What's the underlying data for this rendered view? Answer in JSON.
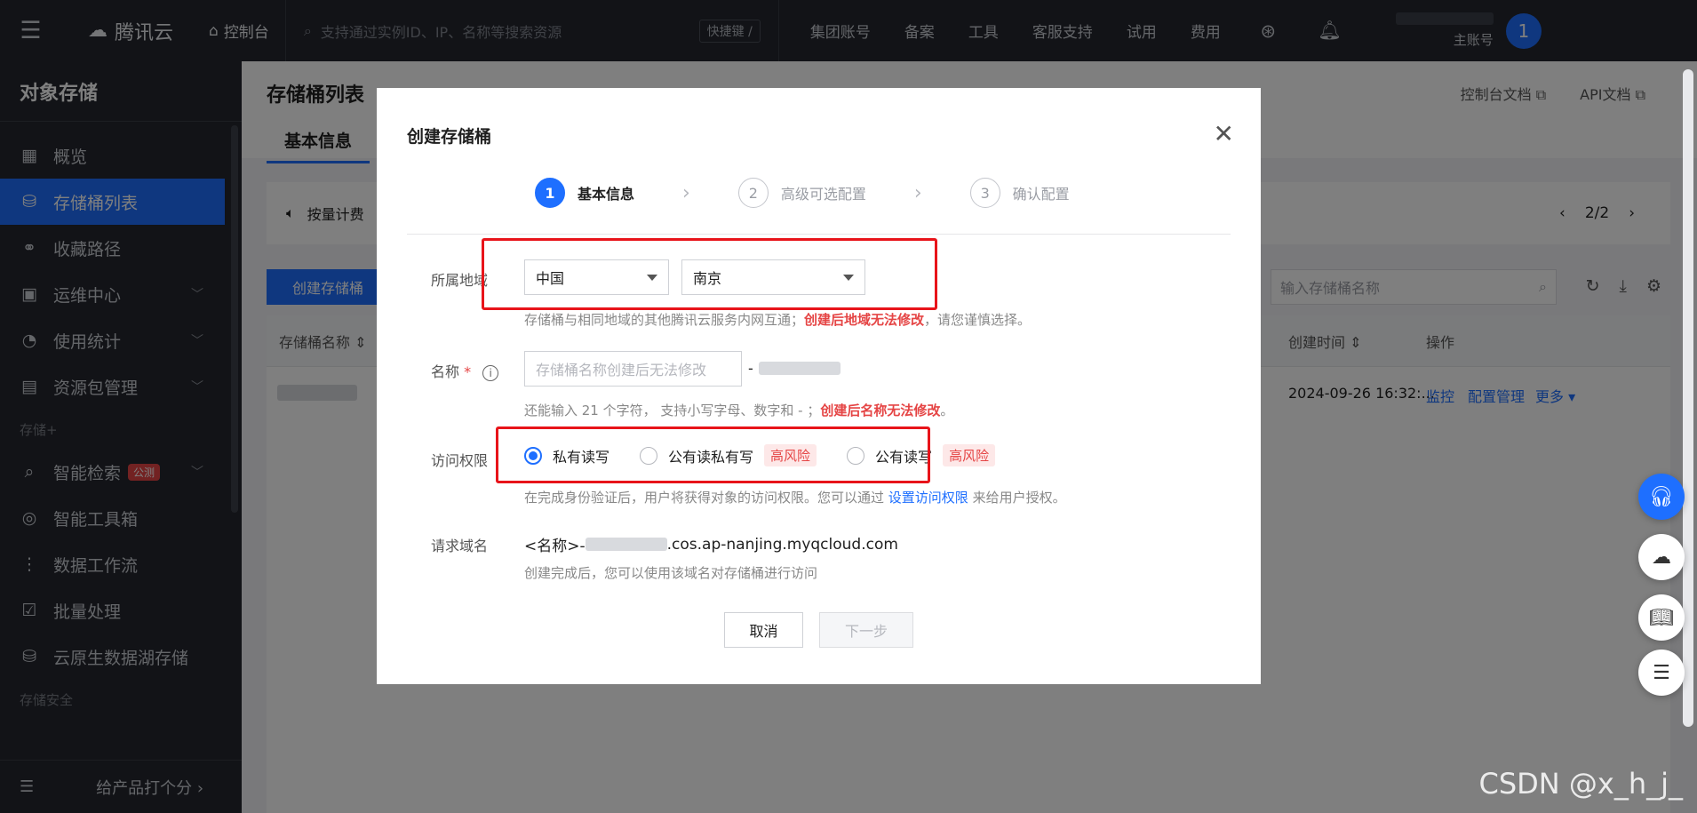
{
  "topbar": {
    "brand": "腾讯云",
    "console": "控制台",
    "search_placeholder": "支持通过实例ID、IP、名称等搜索资源",
    "shortcut": "快捷键 /",
    "links": [
      "集团账号",
      "备案",
      "工具",
      "客服支持",
      "试用",
      "费用"
    ],
    "account_role": "主账号",
    "avatar_initial": "1"
  },
  "sidebar": {
    "title": "对象存储",
    "items": [
      {
        "label": "概览",
        "icon": "grid-icon"
      },
      {
        "label": "存储桶列表",
        "icon": "bucket-icon"
      },
      {
        "label": "收藏路径",
        "icon": "link-icon"
      },
      {
        "label": "运维中心",
        "icon": "calendar-icon"
      },
      {
        "label": "使用统计",
        "icon": "pie-icon"
      },
      {
        "label": "资源包管理",
        "icon": "package-icon"
      }
    ],
    "group_storage_plus": "存储+",
    "plus_items": [
      {
        "label": "智能检索",
        "icon": "search-doc-icon",
        "badge": "公测"
      },
      {
        "label": "智能工具箱",
        "icon": "toolbox-icon"
      },
      {
        "label": "数据工作流",
        "icon": "workflow-icon"
      },
      {
        "label": "批量处理",
        "icon": "batch-icon"
      },
      {
        "label": "云原生数据湖存储",
        "icon": "lake-icon"
      }
    ],
    "group_security": "存储安全",
    "footer_label": "给产品打个分"
  },
  "page": {
    "title": "存储桶列表",
    "tab": "基本信息",
    "doc_links": [
      "控制台文档",
      "API文档"
    ],
    "notice": "按量计费",
    "pager": "2/2",
    "create_button": "创建存储桶",
    "search_placeholder": "输入存储桶名称",
    "columns": [
      "存储桶名称",
      "创建时间",
      "操作"
    ],
    "row": {
      "created": "2024-09-26 16:32:...",
      "actions": [
        "监控",
        "配置管理",
        "更多"
      ]
    }
  },
  "modal": {
    "title": "创建存储桶",
    "steps": [
      {
        "num": "1",
        "label": "基本信息"
      },
      {
        "num": "2",
        "label": "高级可选配置"
      },
      {
        "num": "3",
        "label": "确认配置"
      }
    ],
    "region": {
      "label": "所属地域",
      "country": "中国",
      "city": "南京",
      "hint_prefix": "存储桶与相同地域的其他腾讯云服务内网互通；",
      "hint_warn": "创建后地域无法修改",
      "hint_suffix": "，请您谨慎选择。"
    },
    "name": {
      "label": "名称",
      "required_mark": "*",
      "placeholder": "存储桶名称创建后无法修改",
      "suffix": "-",
      "hint_prefix": "还能输入 21 个字符， 支持小写字母、数字和 - ；",
      "hint_warn": "创建后名称无法修改",
      "hint_suffix": "。"
    },
    "access": {
      "label": "访问权限",
      "options": [
        {
          "label": "私有读写",
          "selected": true
        },
        {
          "label": "公有读私有写",
          "selected": false,
          "tag": "高风险"
        },
        {
          "label": "公有读写",
          "selected": false,
          "tag": "高风险"
        }
      ],
      "hint_prefix": "在完成身份验证后，用户将获得对象的访问权限。您可以通过",
      "hint_link": "设置访问权限",
      "hint_suffix": "来给用户授权。"
    },
    "domain": {
      "label": "请求域名",
      "prefix": "<名称>-",
      "value": ".cos.ap-nanjing.myqcloud.com",
      "hint": "创建完成后，您可以使用该域名对存储桶进行访问"
    },
    "buttons": {
      "cancel": "取消",
      "next": "下一步"
    }
  },
  "watermark": "CSDN @x_h_j_",
  "colors": {
    "accent": "#1e6fff",
    "danger": "#e54545",
    "highlight_box": "#e8141a",
    "topbar": "#24272e"
  }
}
